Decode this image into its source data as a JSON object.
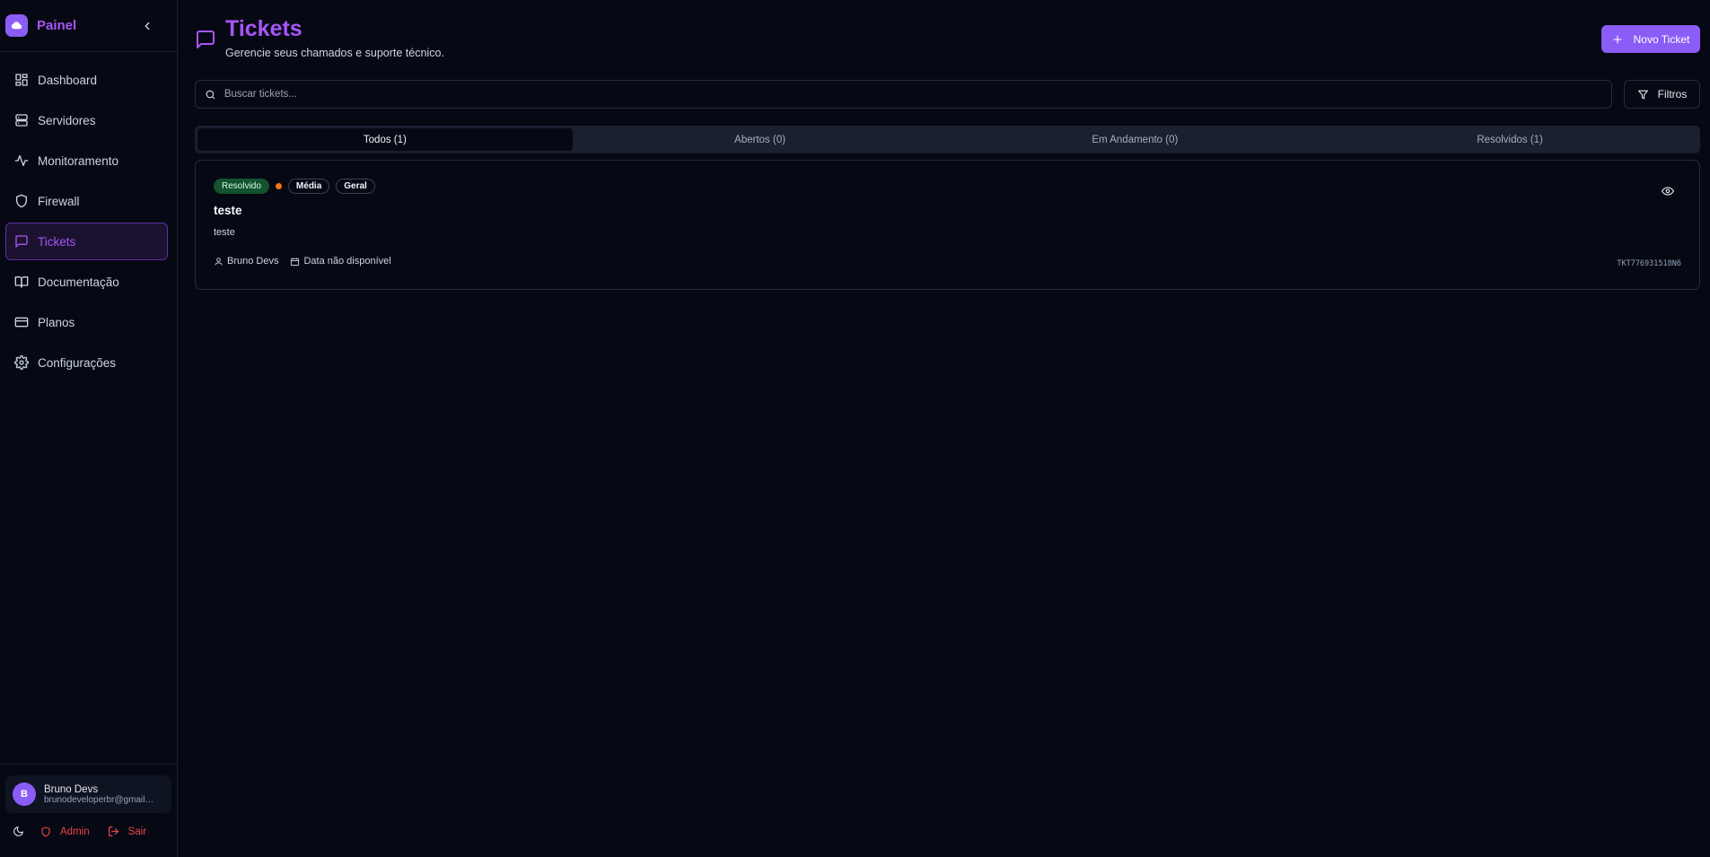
{
  "brand": {
    "name": "Painel",
    "logo_icon": "cloud-logo-icon"
  },
  "sidebar": {
    "items": [
      {
        "label": "Dashboard",
        "icon": "dashboard-icon",
        "active": false
      },
      {
        "label": "Servidores",
        "icon": "server-icon",
        "active": false
      },
      {
        "label": "Monitoramento",
        "icon": "activity-icon",
        "active": false
      },
      {
        "label": "Firewall",
        "icon": "shield-icon",
        "active": false
      },
      {
        "label": "Tickets",
        "icon": "message-square-icon",
        "active": true
      },
      {
        "label": "Documentação",
        "icon": "book-icon",
        "active": false
      },
      {
        "label": "Planos",
        "icon": "credit-card-icon",
        "active": false
      },
      {
        "label": "Configurações",
        "icon": "gear-icon",
        "active": false
      }
    ]
  },
  "user": {
    "initial": "B",
    "name": "Bruno Devs",
    "email": "brunodeveloperbr@gmail.com"
  },
  "footer": {
    "admin_label": "Admin",
    "logout_label": "Sair"
  },
  "header": {
    "title": "Tickets",
    "subtitle": "Gerencie seus chamados e suporte técnico.",
    "new_ticket_label": "Novo Ticket"
  },
  "search": {
    "placeholder": "Buscar tickets...",
    "value": ""
  },
  "filters_label": "Filtros",
  "tabs": [
    {
      "label": "Todos (1)",
      "active": true
    },
    {
      "label": "Abertos (0)",
      "active": false
    },
    {
      "label": "Em Andamento (0)",
      "active": false
    },
    {
      "label": "Resolvidos (1)",
      "active": false
    }
  ],
  "tickets": [
    {
      "status": "Resolvido",
      "priority": "Média",
      "category": "Geral",
      "title": "teste",
      "description": "teste",
      "author": "Bruno Devs",
      "date": "Data não disponível",
      "id": "TKT776931518N6"
    }
  ],
  "colors": {
    "accent": "#8b5cf6",
    "accent_text": "#a855f7",
    "background": "#060914",
    "status_resolved": "#14532d",
    "priority_dot": "#f97316",
    "danger": "#ef4444"
  }
}
